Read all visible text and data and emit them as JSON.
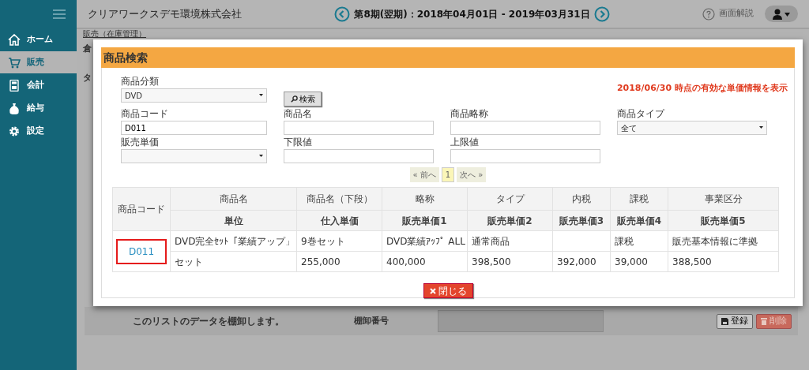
{
  "sidebar": {
    "items": [
      {
        "label": "ホーム",
        "selected": false
      },
      {
        "label": "販売",
        "selected": true
      },
      {
        "label": "会計",
        "selected": false
      },
      {
        "label": "給与",
        "selected": false
      },
      {
        "label": "設定",
        "selected": false
      }
    ]
  },
  "header": {
    "company": "クリアワークスデモ環境株式会社",
    "period": "第8期(翌期)：2018年04月01日 - 2019年03月31日",
    "help": "画面解説"
  },
  "page": {
    "breadcrumb": "販売（在庫管理）",
    "cut_labels": [
      "倉",
      "タ"
    ],
    "footer": {
      "message": "このリストのデータを棚卸します。",
      "number_label": "棚卸番号",
      "buttons": [
        {
          "label": "登録",
          "kind": "save"
        },
        {
          "label": "削除",
          "kind": "delete"
        }
      ]
    }
  },
  "modal": {
    "title": "商品検索",
    "form_rows": [
      [
        {
          "kind": "select",
          "label": "商品分類",
          "value": "DVD"
        },
        {
          "kind": "button",
          "label": "検索"
        },
        {
          "kind": "note",
          "text": "2018/06/30 時点の有効な単価情報を表示"
        }
      ],
      [
        {
          "kind": "input",
          "label": "商品コード",
          "value": "D011"
        },
        {
          "kind": "input",
          "label": "商品名"
        },
        {
          "kind": "input",
          "label": "商品略称"
        },
        {
          "kind": "select",
          "label": "商品タイプ",
          "value": "全て"
        }
      ],
      [
        {
          "kind": "select",
          "label": "販売単価"
        },
        {
          "kind": "input",
          "label": "下限値"
        },
        {
          "kind": "input",
          "label": "上限値"
        }
      ]
    ],
    "pagination": {
      "prev": "« 前へ",
      "pages": [
        {
          "label": "1",
          "selected": true
        }
      ],
      "next": "次へ »"
    },
    "table": {
      "code_header": "商品コード",
      "header_rows": [
        [
          "商品名",
          "商品名（下段）",
          "略称",
          "タイプ",
          "内税",
          "課税",
          "事業区分"
        ],
        [
          "単位",
          "仕入単価",
          "販売単価1",
          "販売単価2",
          "販売単価3",
          "販売単価4",
          "販売単価5"
        ]
      ],
      "items": [
        {
          "code": "D011",
          "highlighted": true,
          "lines": [
            {
              "column_1": "DVD完全ｾｯﾄ「業績アップ」",
              "column_2": "9巻セット",
              "column_3": "DVD業績ｱｯﾌﾟ ALL",
              "column_4": "通常商品",
              "column_6": "課税",
              "column_7": "販売基本情報に準拠"
            },
            {
              "column_1": "セット",
              "column_2": "255,000",
              "column_3": "400,000",
              "column_4": "398,500",
              "column_5": "392,000",
              "column_6": "39,000",
              "column_7": "388,500"
            }
          ]
        }
      ]
    },
    "close": "閉じる"
  }
}
